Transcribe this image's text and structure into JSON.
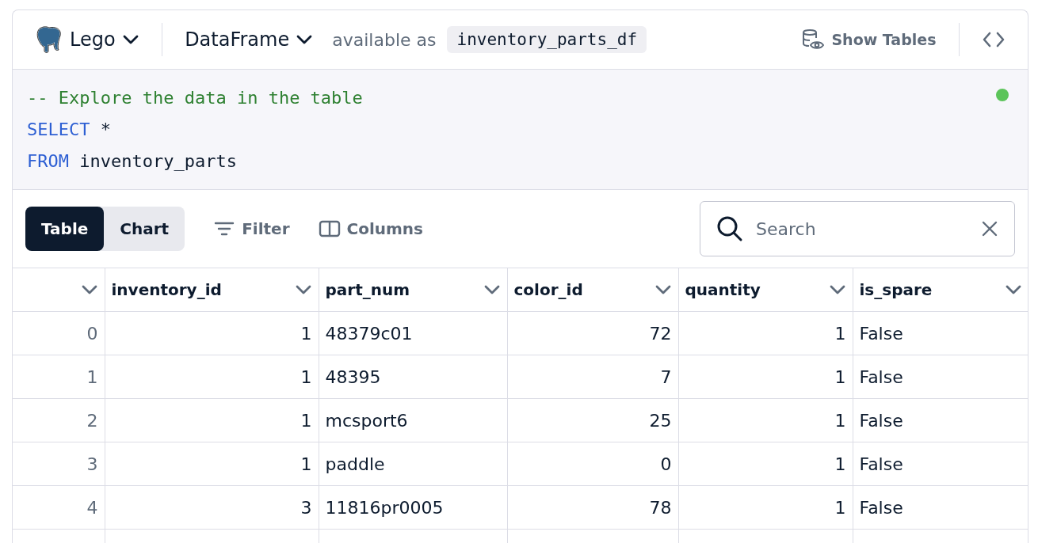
{
  "header": {
    "connection": "Lego",
    "output_type": "DataFrame",
    "available_label": "available as",
    "variable": "inventory_parts_df",
    "show_tables": "Show Tables"
  },
  "editor": {
    "run_succeeded": true,
    "lines": [
      [
        {
          "kind": "comment",
          "text": "-- Explore the data in the table"
        }
      ],
      [
        {
          "kind": "keyword",
          "text": "SELECT"
        },
        {
          "kind": "plain",
          "text": " *"
        }
      ],
      [
        {
          "kind": "keyword",
          "text": "FROM"
        },
        {
          "kind": "plain",
          "text": " inventory_parts"
        }
      ]
    ]
  },
  "toolbar": {
    "views": [
      {
        "label": "Table",
        "selected": true
      },
      {
        "label": "Chart",
        "selected": false
      }
    ],
    "filter": "Filter",
    "columns": "Columns",
    "search": {
      "placeholder": "Search"
    }
  },
  "table": {
    "columns": [
      {
        "kind": "number"
      },
      {
        "label": "inventory_id",
        "kind": "number"
      },
      {
        "label": "part_num",
        "kind": "text"
      },
      {
        "label": "color_id",
        "kind": "number"
      },
      {
        "label": "quantity",
        "kind": "number"
      },
      {
        "label": "is_spare",
        "kind": "text"
      }
    ],
    "rows": [
      [
        "0",
        "1",
        "48379c01",
        "72",
        "1",
        "False"
      ],
      [
        "1",
        "1",
        "48395",
        "7",
        "1",
        "False"
      ],
      [
        "2",
        "1",
        "mcsport6",
        "25",
        "1",
        "False"
      ],
      [
        "3",
        "1",
        "paddle",
        "0",
        "1",
        "False"
      ],
      [
        "4",
        "3",
        "11816pr0005",
        "78",
        "1",
        "False"
      ]
    ]
  }
}
